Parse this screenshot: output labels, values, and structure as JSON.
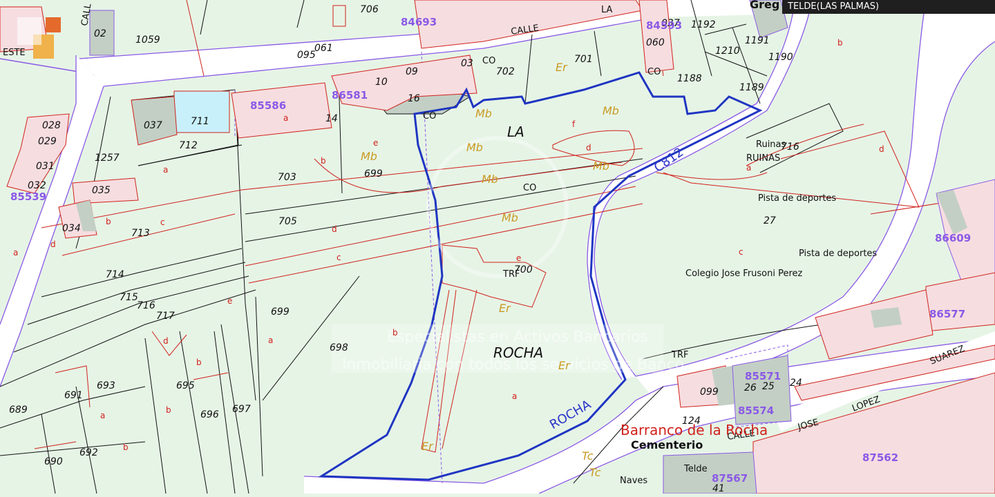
{
  "header": {
    "title": "TELDE(LAS PALMAS)"
  },
  "place_names": [
    {
      "id": "la",
      "text": "LA"
    },
    {
      "id": "rocha",
      "text": "ROCHA"
    }
  ],
  "parcels": [
    {
      "id": "p1059",
      "text": "1059"
    },
    {
      "id": "p706",
      "text": "706"
    },
    {
      "id": "p702",
      "text": "702"
    },
    {
      "id": "p701",
      "text": "701"
    },
    {
      "id": "p1192",
      "text": "1192"
    },
    {
      "id": "p1210",
      "text": "1210"
    },
    {
      "id": "p1191",
      "text": "1191"
    },
    {
      "id": "p1190",
      "text": "1190"
    },
    {
      "id": "p1188",
      "text": "1188"
    },
    {
      "id": "p1189",
      "text": "1189"
    },
    {
      "id": "p711",
      "text": "711"
    },
    {
      "id": "p037",
      "text": "037"
    },
    {
      "id": "p712",
      "text": "712"
    },
    {
      "id": "p1257",
      "text": "1257"
    },
    {
      "id": "p035",
      "text": "035"
    },
    {
      "id": "p703",
      "text": "703"
    },
    {
      "id": "p699a",
      "text": "699"
    },
    {
      "id": "p705",
      "text": "705"
    },
    {
      "id": "p713",
      "text": "713"
    },
    {
      "id": "p714",
      "text": "714"
    },
    {
      "id": "p715",
      "text": "715"
    },
    {
      "id": "p716",
      "text": "716"
    },
    {
      "id": "p717",
      "text": "717"
    },
    {
      "id": "p699b",
      "text": "699"
    },
    {
      "id": "p698",
      "text": "698"
    },
    {
      "id": "p693",
      "text": "693"
    },
    {
      "id": "p691",
      "text": "691"
    },
    {
      "id": "p695",
      "text": "695"
    },
    {
      "id": "p696",
      "text": "696"
    },
    {
      "id": "p697",
      "text": "697"
    },
    {
      "id": "p689",
      "text": "689"
    },
    {
      "id": "p690",
      "text": "690"
    },
    {
      "id": "p692",
      "text": "692"
    },
    {
      "id": "p700",
      "text": "700"
    },
    {
      "id": "p034",
      "text": "034"
    },
    {
      "id": "p028",
      "text": "028"
    },
    {
      "id": "p029",
      "text": "029"
    },
    {
      "id": "p031",
      "text": "031"
    },
    {
      "id": "p032",
      "text": "032"
    },
    {
      "id": "p02",
      "text": "02"
    },
    {
      "id": "p16",
      "text": "16"
    },
    {
      "id": "p14",
      "text": "14"
    },
    {
      "id": "p10",
      "text": "10"
    },
    {
      "id": "p09",
      "text": "09"
    },
    {
      "id": "p03",
      "text": "03"
    },
    {
      "id": "p716b",
      "text": "716"
    },
    {
      "id": "p27",
      "text": "27"
    },
    {
      "id": "p124",
      "text": "124"
    },
    {
      "id": "p099",
      "text": "099"
    },
    {
      "id": "p26",
      "text": "26"
    },
    {
      "id": "p25",
      "text": "25"
    },
    {
      "id": "p24",
      "text": "24"
    },
    {
      "id": "p41",
      "text": "41"
    },
    {
      "id": "p037b",
      "text": "037"
    },
    {
      "id": "p060",
      "text": "060"
    },
    {
      "id": "p095",
      "text": "095"
    },
    {
      "id": "p061",
      "text": "061"
    }
  ],
  "refs": [
    {
      "id": "r84693",
      "text": "84693"
    },
    {
      "id": "r84593",
      "text": "84593"
    },
    {
      "id": "r86581",
      "text": "86581"
    },
    {
      "id": "r85586",
      "text": "85586"
    },
    {
      "id": "r85571",
      "text": "85571"
    },
    {
      "id": "r85574",
      "text": "85574"
    },
    {
      "id": "r87567",
      "text": "87567"
    },
    {
      "id": "r87562",
      "text": "87562"
    },
    {
      "id": "r86577",
      "text": "86577"
    },
    {
      "id": "r86609",
      "text": "86609"
    },
    {
      "id": "r85539",
      "text": "85539"
    }
  ],
  "zones": [
    {
      "id": "z1",
      "text": "Mb"
    },
    {
      "id": "z2",
      "text": "Mb"
    },
    {
      "id": "z3",
      "text": "Mb"
    },
    {
      "id": "z4",
      "text": "Mb"
    },
    {
      "id": "z5",
      "text": "Mb"
    },
    {
      "id": "z6",
      "text": "Mb"
    },
    {
      "id": "z7",
      "text": "Mb"
    },
    {
      "id": "z8",
      "text": "Er"
    },
    {
      "id": "z9",
      "text": "Er"
    },
    {
      "id": "z10",
      "text": "Er"
    },
    {
      "id": "z11",
      "text": "Er"
    },
    {
      "id": "z12",
      "text": "Tc"
    },
    {
      "id": "z13",
      "text": "Tc"
    }
  ],
  "subparcels": [
    {
      "id": "s1",
      "text": "a"
    },
    {
      "id": "s2",
      "text": "b"
    },
    {
      "id": "s3",
      "text": "c"
    },
    {
      "id": "s4",
      "text": "d"
    },
    {
      "id": "s5",
      "text": "e"
    },
    {
      "id": "s6",
      "text": "f"
    },
    {
      "id": "s7",
      "text": "d"
    },
    {
      "id": "s8",
      "text": "a"
    },
    {
      "id": "s9",
      "text": "b"
    },
    {
      "id": "s10",
      "text": "c"
    },
    {
      "id": "s11",
      "text": "d"
    },
    {
      "id": "s12",
      "text": "e"
    },
    {
      "id": "s13",
      "text": "a"
    },
    {
      "id": "s14",
      "text": "b"
    },
    {
      "id": "s15",
      "text": "a"
    },
    {
      "id": "s16",
      "text": "b"
    },
    {
      "id": "s17",
      "text": "a"
    },
    {
      "id": "s18",
      "text": "c"
    },
    {
      "id": "s19",
      "text": "d"
    },
    {
      "id": "s20",
      "text": "a"
    },
    {
      "id": "s21",
      "text": "b"
    },
    {
      "id": "s22",
      "text": "a"
    },
    {
      "id": "s23",
      "text": "b"
    },
    {
      "id": "s24",
      "text": "d"
    },
    {
      "id": "s25",
      "text": "b"
    },
    {
      "id": "s26",
      "text": "e"
    }
  ],
  "labels": [
    {
      "id": "calle_top",
      "text": "CALLE"
    },
    {
      "id": "la_top",
      "text": "LA"
    },
    {
      "id": "co1",
      "text": "CO"
    },
    {
      "id": "co2",
      "text": "CO"
    },
    {
      "id": "co3",
      "text": "CO"
    },
    {
      "id": "co4",
      "text": "CO"
    },
    {
      "id": "ruinas1",
      "text": "Ruinas"
    },
    {
      "id": "ruinas2",
      "text": "RUINAS"
    },
    {
      "id": "pista1",
      "text": "Pista de deportes"
    },
    {
      "id": "pista2",
      "text": "Pista de deportes"
    },
    {
      "id": "colegio",
      "text": "Colegio Jose Frusoni Perez"
    },
    {
      "id": "trf1",
      "text": "TRF"
    },
    {
      "id": "trf2",
      "text": "TRF"
    },
    {
      "id": "calle_b",
      "text": "CALLE"
    },
    {
      "id": "jose",
      "text": "JOSE"
    },
    {
      "id": "lopez",
      "text": "LOPEZ"
    },
    {
      "id": "suarez",
      "text": "SUAREZ"
    },
    {
      "id": "telde",
      "text": "Telde"
    },
    {
      "id": "naves",
      "text": "Naves"
    },
    {
      "id": "greg",
      "text": "Greg"
    },
    {
      "id": "calle_left",
      "text": "CALL"
    },
    {
      "id": "este",
      "text": "ESTE"
    }
  ],
  "road_labels": [
    {
      "id": "c812",
      "text": "C812"
    },
    {
      "id": "rocha_road",
      "text": "ROCHA"
    }
  ],
  "barranco": "Barranco de la Rocha",
  "cementerio": "Cementerio",
  "watermark": {
    "line1": "Especialistas en Activos Bancarios",
    "line2": "Inmobiliaria con todos los servicios de Banco"
  },
  "colors": {
    "land": "#e6f4e6",
    "road": "#ffffff",
    "parcel_line": "#111111",
    "subparcel_line": "#d0221b",
    "ref_line": "#8b59e6",
    "plot_border": "#1f35c2",
    "building": "#c3cfc5",
    "highlight": "#c8f0fb"
  }
}
